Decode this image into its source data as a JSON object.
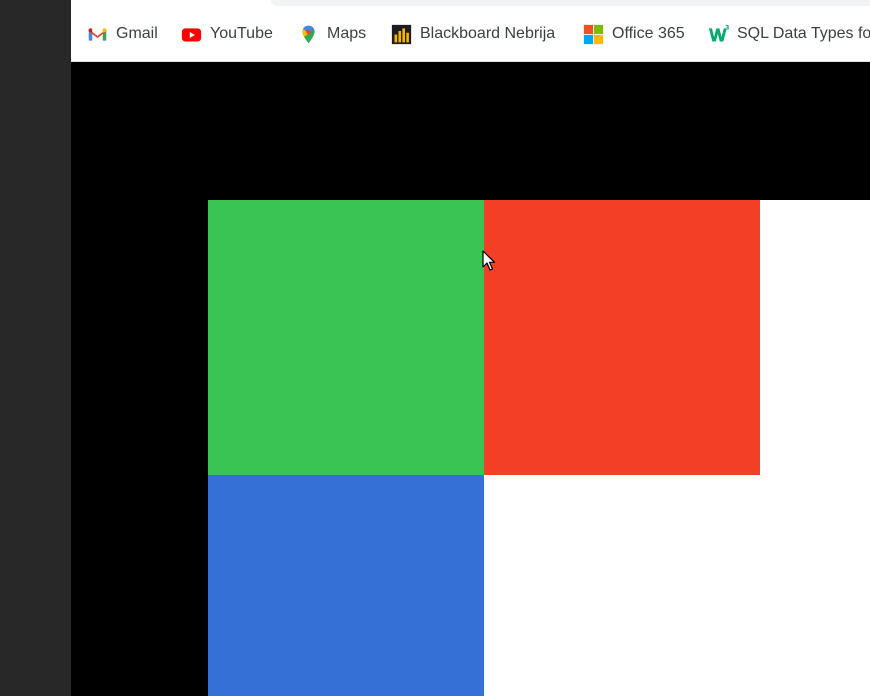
{
  "bookmarks": [
    {
      "label": "Gmail",
      "icon": "gmail-icon"
    },
    {
      "label": "YouTube",
      "icon": "youtube-icon"
    },
    {
      "label": "Maps",
      "icon": "maps-icon"
    },
    {
      "label": "Blackboard Nebrija",
      "icon": "blackboard-icon"
    },
    {
      "label": "Office 365",
      "icon": "office-icon"
    },
    {
      "label": "SQL Data Types fo",
      "icon": "w3schools-icon"
    }
  ],
  "colors": {
    "green": "#39c454",
    "red": "#f23f26",
    "blue": "#3570d6",
    "white": "#ffffff",
    "black": "#000000"
  }
}
